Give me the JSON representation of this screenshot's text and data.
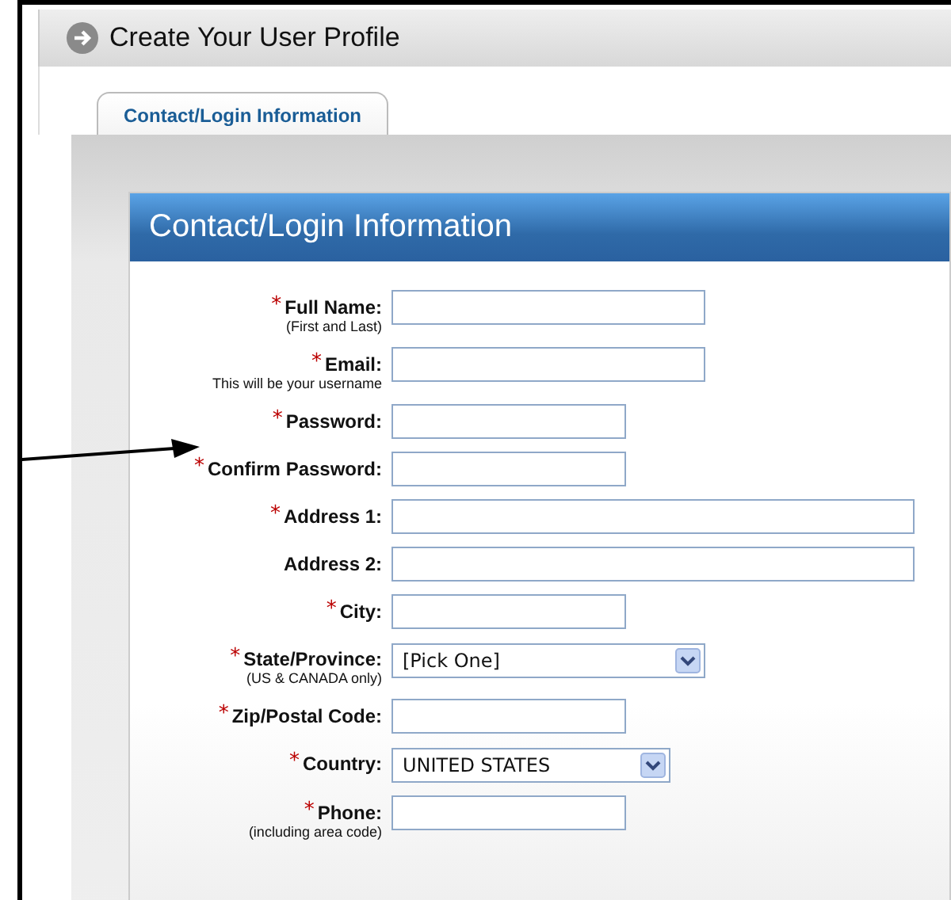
{
  "page_title": "Create Your User Profile",
  "tabs": [
    {
      "label": "Contact/Login Information",
      "selected": true
    }
  ],
  "section_title": "Contact/Login Information",
  "fields": [
    {
      "kind": "text",
      "marker": "*",
      "label": "Full Name:",
      "hint": "(First and Last)"
    },
    {
      "kind": "text",
      "marker": "*",
      "label": "Email:",
      "hint": "This will be your username"
    },
    {
      "kind": "text",
      "marker": "*",
      "label": "Password:"
    },
    {
      "kind": "text",
      "marker": "*",
      "label": "Confirm Password:"
    },
    {
      "kind": "text",
      "marker": "*",
      "label": "Address 1:"
    },
    {
      "kind": "text",
      "label": "Address 2:"
    },
    {
      "kind": "text",
      "marker": "*",
      "label": "City:"
    },
    {
      "kind": "select",
      "marker": "*",
      "label": "State/Province:",
      "hint": "(US & CANADA only)",
      "value": "[Pick One]"
    },
    {
      "kind": "text",
      "marker": "*",
      "label": "Zip/Postal Code:"
    },
    {
      "kind": "select",
      "marker": "*",
      "label": "Country:",
      "value": "UNITED STATES"
    },
    {
      "kind": "text",
      "marker": "*",
      "label": "Phone:",
      "hint": "(including area code)"
    }
  ]
}
